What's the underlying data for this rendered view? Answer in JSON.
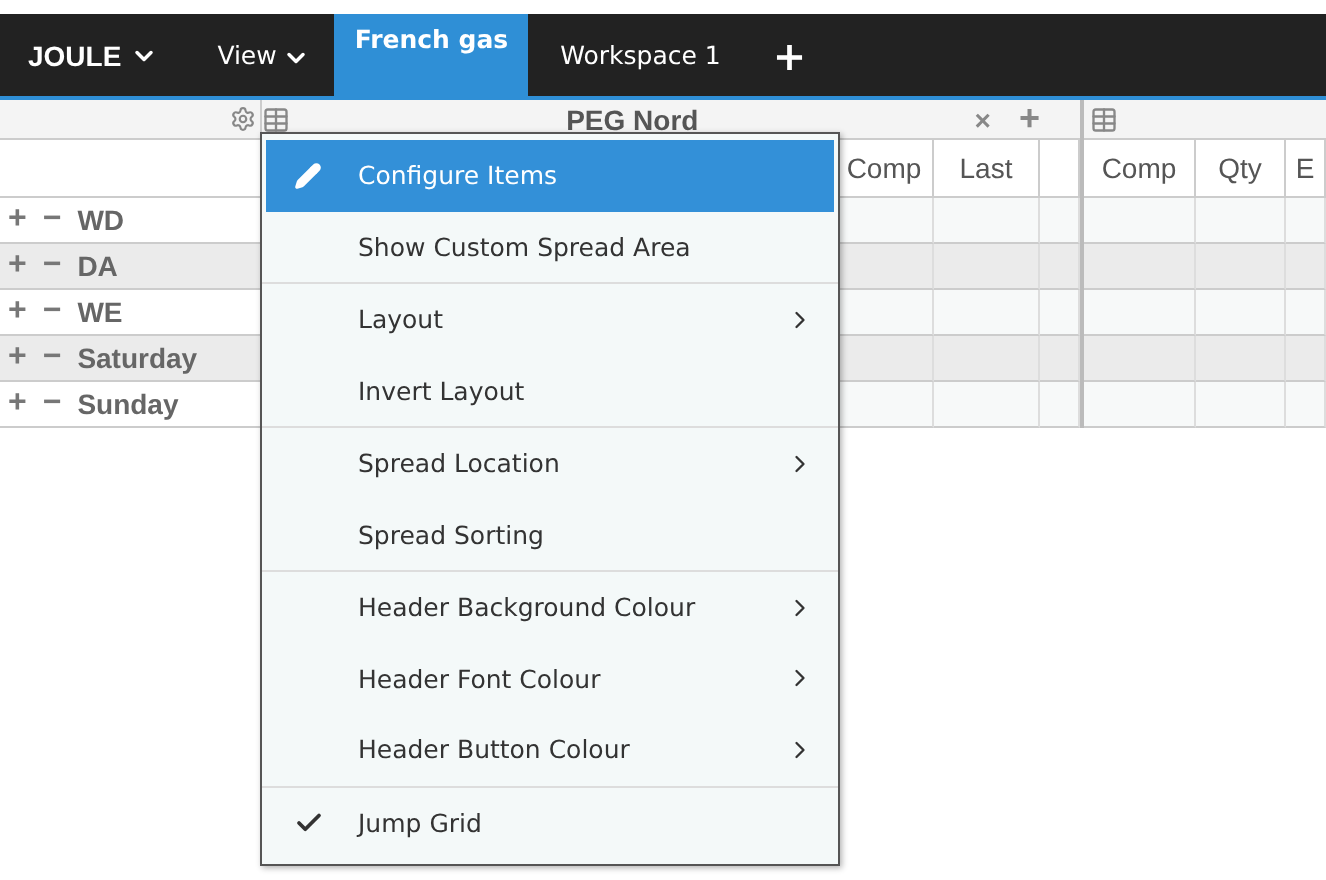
{
  "nav": {
    "brand": "JOULE",
    "tabs": [
      {
        "label": "View",
        "dropdown": true,
        "selected": false
      },
      {
        "label": "French gas",
        "dropdown": false,
        "selected": true
      },
      {
        "label": "Workspace 1",
        "dropdown": false,
        "selected": false
      }
    ],
    "add_tab": "+"
  },
  "grid": {
    "panels": [
      {
        "title": "PEG Nord",
        "close": "×",
        "add": "+"
      }
    ],
    "columns": [
      "Comp",
      "Last",
      "",
      "Comp",
      "Qty",
      "E"
    ],
    "rows": [
      {
        "label": "WD",
        "expand": "+",
        "collapse": "−"
      },
      {
        "label": "DA",
        "expand": "+",
        "collapse": "−"
      },
      {
        "label": "WE",
        "expand": "+",
        "collapse": "−"
      },
      {
        "label": "Saturday",
        "expand": "+",
        "collapse": "−"
      },
      {
        "label": "Sunday",
        "expand": "+",
        "collapse": "−"
      }
    ]
  },
  "menu": {
    "groups": [
      [
        {
          "label": "Configure Items",
          "kind": "edit",
          "selected": true,
          "submenu": false,
          "checked": false
        },
        {
          "label": "Show Custom Spread Area",
          "selected": false,
          "submenu": false,
          "checked": false
        }
      ],
      [
        {
          "label": "Layout",
          "selected": false,
          "submenu": true,
          "checked": false
        },
        {
          "label": "Invert Layout",
          "selected": false,
          "submenu": false,
          "checked": false
        }
      ],
      [
        {
          "label": "Spread Location",
          "selected": false,
          "submenu": true,
          "checked": false
        },
        {
          "label": "Spread Sorting",
          "selected": false,
          "submenu": false,
          "checked": false
        }
      ],
      [
        {
          "label": "Header Background Colour",
          "selected": false,
          "submenu": true,
          "checked": false
        },
        {
          "label": "Header Font Colour",
          "selected": false,
          "submenu": true,
          "checked": false
        },
        {
          "label": "Header Button Colour",
          "selected": false,
          "submenu": true,
          "checked": false
        }
      ],
      [
        {
          "label": "Jump Grid",
          "selected": false,
          "submenu": false,
          "checked": true
        }
      ]
    ]
  }
}
